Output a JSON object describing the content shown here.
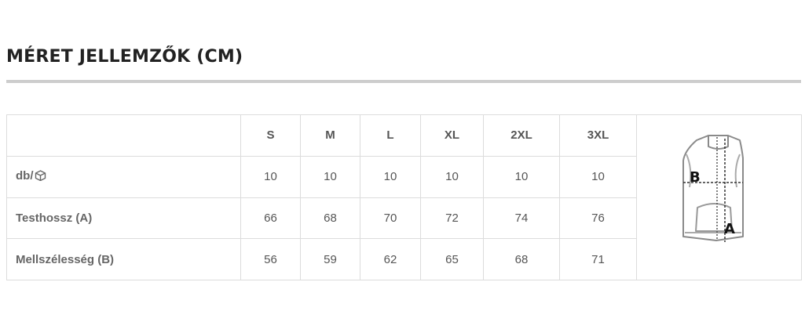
{
  "title": "MÉRET JELLEMZŐK (CM)",
  "table": {
    "headers": [
      "",
      "S",
      "M",
      "L",
      "XL",
      "2XL",
      "3XL"
    ],
    "rows": [
      {
        "label": "db/",
        "icon": "box-icon",
        "values": [
          "10",
          "10",
          "10",
          "10",
          "10",
          "10"
        ]
      },
      {
        "label": "Testhossz (A)",
        "values": [
          "66",
          "68",
          "70",
          "72",
          "74",
          "76"
        ]
      },
      {
        "label": "Mellszélesség (B)",
        "values": [
          "56",
          "59",
          "62",
          "65",
          "68",
          "71"
        ]
      }
    ]
  },
  "diagram": {
    "label_b": "B",
    "label_a": "A",
    "icon": "vest-diagram"
  }
}
